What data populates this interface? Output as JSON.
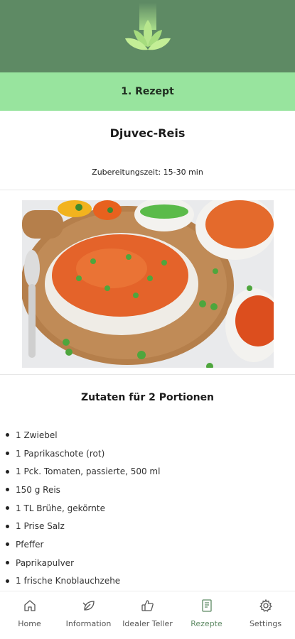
{
  "header": {
    "logo_icon": "lotus-leaf-logo",
    "color": "#5e8a64"
  },
  "titlebar": {
    "label": "1. Rezept",
    "color": "#98e49e"
  },
  "recipe": {
    "name": "Djuvec-Reis",
    "prep_time": "Zubereitungszeit: 15-30 min",
    "photo_icon": "recipe-photo"
  },
  "ingredients": {
    "title": "Zutaten für 2 Portionen",
    "items": [
      "1 Zwiebel",
      "1 Paprikaschote (rot)",
      "1 Pck. Tomaten, passierte, 500 ml",
      "150 g Reis",
      "1 TL Brühe, gekörnte",
      "1 Prise Salz",
      "Pfeffer",
      "Paprikapulver",
      "1 frische Knoblauchzehe"
    ]
  },
  "nav": {
    "active": "Rezepte",
    "items": [
      {
        "label": "Home",
        "icon": "home-icon"
      },
      {
        "label": "Information",
        "icon": "leaf-icon"
      },
      {
        "label": "Idealer Teller",
        "icon": "thumbs-up-icon"
      },
      {
        "label": "Rezepte",
        "icon": "recipe-book-icon"
      },
      {
        "label": "Settings",
        "icon": "gear-icon"
      }
    ]
  }
}
